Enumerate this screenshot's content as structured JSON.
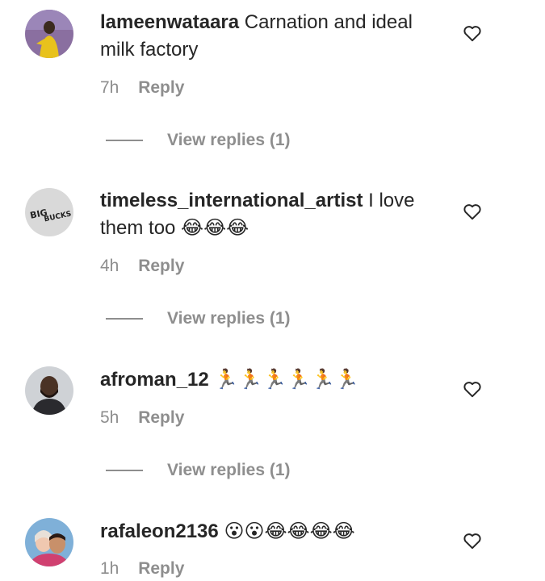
{
  "comments": [
    {
      "username": "lameenwataara",
      "text": "Carnation and ideal milk factory",
      "time": "7h",
      "reply_label": "Reply",
      "view_replies": "View replies (1)",
      "avatar_icon": "avatar-photo"
    },
    {
      "username": "timeless_international_artist",
      "text": "I love them too 😂😂😂",
      "time": "4h",
      "reply_label": "Reply",
      "view_replies": "View replies (1)",
      "avatar_icon": "avatar-big-bucks-logo",
      "avatar_logo_text_1": "BIG",
      "avatar_logo_text_2": "BUCKS"
    },
    {
      "username": "afroman_12",
      "text": "🏃🏃🏃🏃🏃🏃",
      "time": "5h",
      "reply_label": "Reply",
      "view_replies": "View replies (1)",
      "avatar_icon": "avatar-photo"
    },
    {
      "username": "rafaleon2136",
      "text": "😮😮😂😂😂😂",
      "time": "1h",
      "reply_label": "Reply",
      "avatar_icon": "avatar-photo"
    }
  ],
  "colors": {
    "text": "#262626",
    "secondary": "#8e8e8e",
    "background": "#ffffff"
  }
}
